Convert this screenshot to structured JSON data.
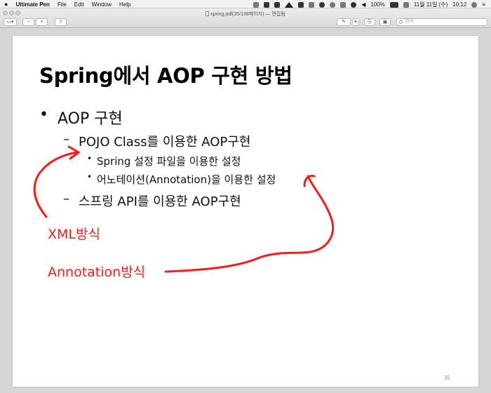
{
  "menubar": {
    "app_name": "Ultimate Pen",
    "items": [
      "File",
      "Edit",
      "Window",
      "Help"
    ],
    "battery": "100%",
    "date": "11월 11일 (수)",
    "time": "10:12"
  },
  "window": {
    "title": "spring.pdf(35/138페이지)",
    "edited": "— 편집됨",
    "search_placeholder": "검색"
  },
  "slide": {
    "title": "Spring에서 AOP 구현 방법",
    "l1_bullet": "•",
    "l1_text": "AOP 구현",
    "l2_dash": "–",
    "l2a_text": "POJO Class를 이용한 AOP구현",
    "l3_bullet": "•",
    "l3a_text": "Spring 설정 파일을 이용한 설정",
    "l3b_text": "어노테이션(Annotation)을 이용한 설정",
    "l2b_text": "스프링 API를 이용한 AOP구현",
    "page_number": "35"
  },
  "annotations": {
    "xml_label": "XML방식",
    "annotation_label": "Annotation방식",
    "ink_color": "#ff1a1a"
  }
}
